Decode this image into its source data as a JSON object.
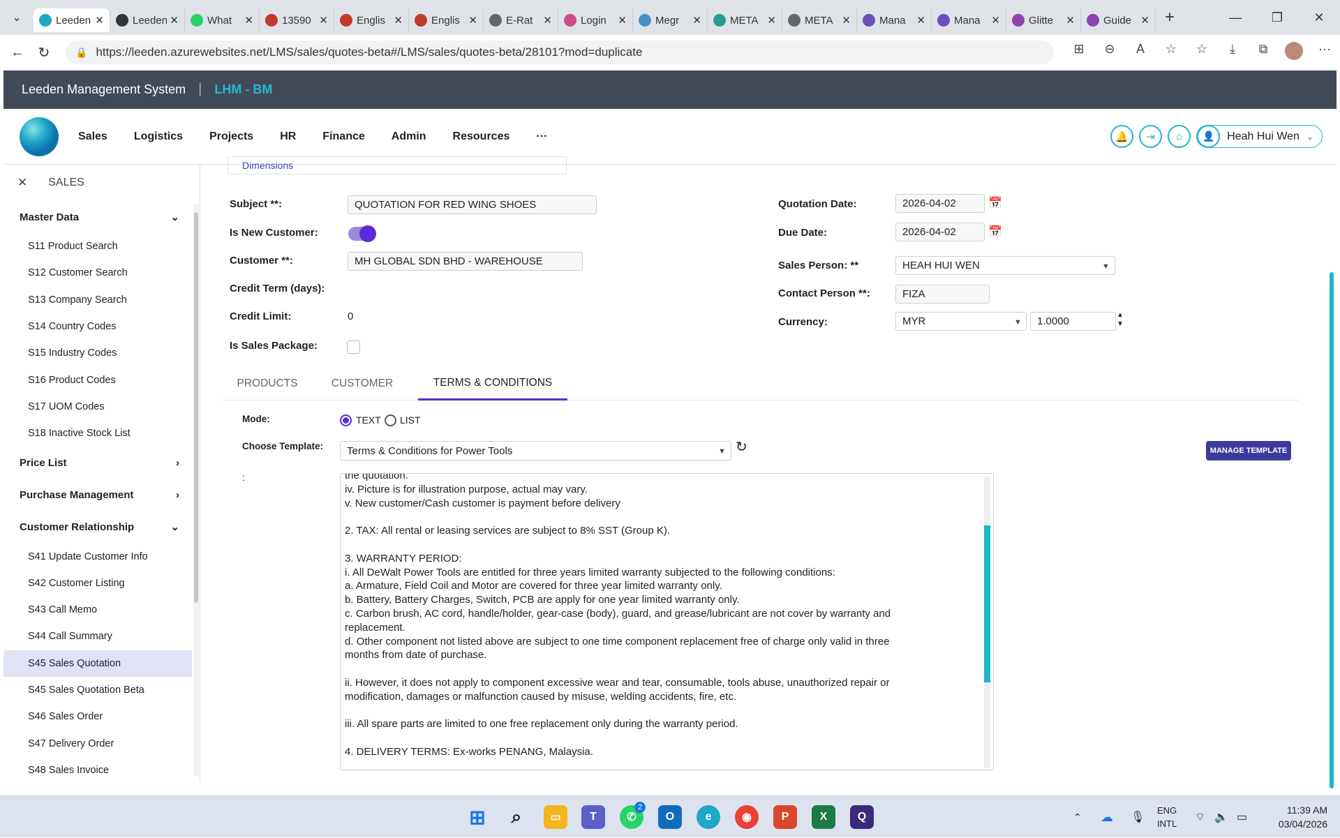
{
  "browser": {
    "tabs": [
      {
        "label": "Leeden",
        "icon": "globe-icon",
        "color": "#1ea7c7",
        "active": true
      },
      {
        "label": "Leeden",
        "icon": "edge-icon",
        "color": "#333333",
        "active": false
      },
      {
        "label": "What",
        "icon": "whatsapp-icon",
        "color": "#25d366",
        "active": false
      },
      {
        "label": "13590",
        "icon": "pdf-icon",
        "color": "#c0392b",
        "active": false
      },
      {
        "label": "Englis",
        "icon": "pdf-icon",
        "color": "#c0392b",
        "active": false
      },
      {
        "label": "Englis",
        "icon": "pdf-icon",
        "color": "#c0392b",
        "active": false
      },
      {
        "label": "E-Rat",
        "icon": "globe-icon",
        "color": "#666666",
        "active": false
      },
      {
        "label": "Login",
        "icon": "gmail-icon",
        "color": "#c94f8a",
        "active": false
      },
      {
        "label": "Megr",
        "icon": "image-icon",
        "color": "#4a90c2",
        "active": false
      },
      {
        "label": "META",
        "icon": "image-icon",
        "color": "#2a9d8f",
        "active": false
      },
      {
        "label": "META",
        "icon": "globe-icon",
        "color": "#666666",
        "active": false
      },
      {
        "label": "Mana",
        "icon": "app-icon",
        "color": "#6b4fbb",
        "active": false
      },
      {
        "label": "Mana",
        "icon": "app-icon",
        "color": "#6b4fbb",
        "active": false
      },
      {
        "label": "Glitte",
        "icon": "g-icon",
        "color": "#8e44ad",
        "active": false
      },
      {
        "label": "Guide",
        "icon": "g-icon",
        "color": "#8e44ad",
        "active": false
      }
    ],
    "url": "https://leeden.azurewebsites.net/LMS/sales/quotes-beta#/LMS/sales/quotes-beta/28101?mod=duplicate"
  },
  "app": {
    "name": "Leeden Management System",
    "module": "LHM - BM",
    "nav": [
      "Sales",
      "Logistics",
      "Projects",
      "HR",
      "Finance",
      "Admin",
      "Resources",
      "···"
    ],
    "user": "Heah Hui Wen"
  },
  "sidebar": {
    "title": "SALES",
    "sections": [
      {
        "label": "Master Data",
        "chevron": "⌄",
        "items": [
          "S11 Product Search",
          "S12 Customer Search",
          "S13 Company Search",
          "S14 Country Codes",
          "S15 Industry Codes",
          "S16 Product Codes",
          "S17 UOM Codes",
          "S18 Inactive Stock List"
        ]
      },
      {
        "label": "Price List",
        "chevron": "›",
        "items": []
      },
      {
        "label": "Purchase Management",
        "chevron": "›",
        "items": []
      },
      {
        "label": "Customer Relationship",
        "chevron": "⌄",
        "items": [
          "S41 Update Customer Info",
          "S42 Customer Listing",
          "S43 Call Memo",
          "S44 Call Summary",
          "S45 Sales Quotation",
          "S45 Sales Quotation Beta",
          "S46 Sales Order",
          "S47 Delivery Order",
          "S48 Sales Invoice"
        ]
      }
    ],
    "active_item": "S45 Sales Quotation"
  },
  "form": {
    "cut_label": "Dimensions",
    "subject_label": "Subject **:",
    "subject_value": "QUOTATION FOR RED WING SHOES",
    "new_customer_label": "Is New Customer:",
    "new_customer_on": true,
    "customer_label": "Customer **:",
    "customer_value": "MH GLOBAL SDN BHD - WAREHOUSE",
    "credit_term_label": "Credit Term (days):",
    "credit_limit_label": "Credit Limit:",
    "credit_limit_value": "0",
    "sales_package_label": "Is Sales Package:",
    "quotation_date_label": "Quotation Date:",
    "quotation_date_value": "2026-04-02",
    "due_date_label": "Due Date:",
    "due_date_value": "2026-04-02",
    "sales_person_label": "Sales Person: **",
    "sales_person_value": "HEAH HUI WEN",
    "contact_person_label": "Contact Person **:",
    "contact_person_value": "FIZA",
    "currency_label": "Currency:",
    "currency_value": "MYR",
    "exchange_rate": "1.0000"
  },
  "tabs": [
    "PRODUCTS",
    "CUSTOMER",
    "TERMS & CONDITIONS"
  ],
  "active_tab": "TERMS & CONDITIONS",
  "terms": {
    "mode_label": "Mode:",
    "mode_text": "TEXT",
    "mode_list": "LIST",
    "template_label": "Choose Template:",
    "template_value": "Terms & Conditions for Power Tools",
    "manage_button": "MANAGE TEMPLATE",
    "text_label": ":",
    "text": "the quotation.\niv. Picture is for illustration purpose, actual may vary.\nv. New customer/Cash customer is payment before delivery\n\n2. TAX: All rental or leasing services are subject to 8% SST (Group K).\n\n3. WARRANTY PERIOD:\ni. All DeWalt Power Tools are entitled for three years limited warranty subjected to the following conditions:\na. Armature, Field Coil and Motor are covered for three year limited warranty only.\nb. Battery, Battery Charges, Switch, PCB are apply for one year limited warranty only.\nc. Carbon brush, AC cord, handle/holder, gear-case (body), guard, and grease/lubricant are not cover by warranty and\nreplacement.\nd. Other component not listed above are subject to one time component replacement free of charge only valid in three\nmonths from date of purchase.\n\nii. However, it does not apply to component excessive wear and tear, consumable, tools abuse, unauthorized repair or\nmodification, damages or malfunction caused by misuse, welding accidents, fire, etc.\n\niii. All spare parts are limited to one free replacement only during the warranty period.\n\n4. DELIVERY TERMS: Ex-works PENANG, Malaysia."
  },
  "taskbar": {
    "lang": "ENG",
    "layout": "INTL",
    "time": "11:39 AM",
    "date": "03/04/2026",
    "whatsapp_badge": "2"
  },
  "colors": {
    "accent": "#5b2bd6",
    "teal": "#1eb6c9",
    "header_bg": "#424a57"
  }
}
